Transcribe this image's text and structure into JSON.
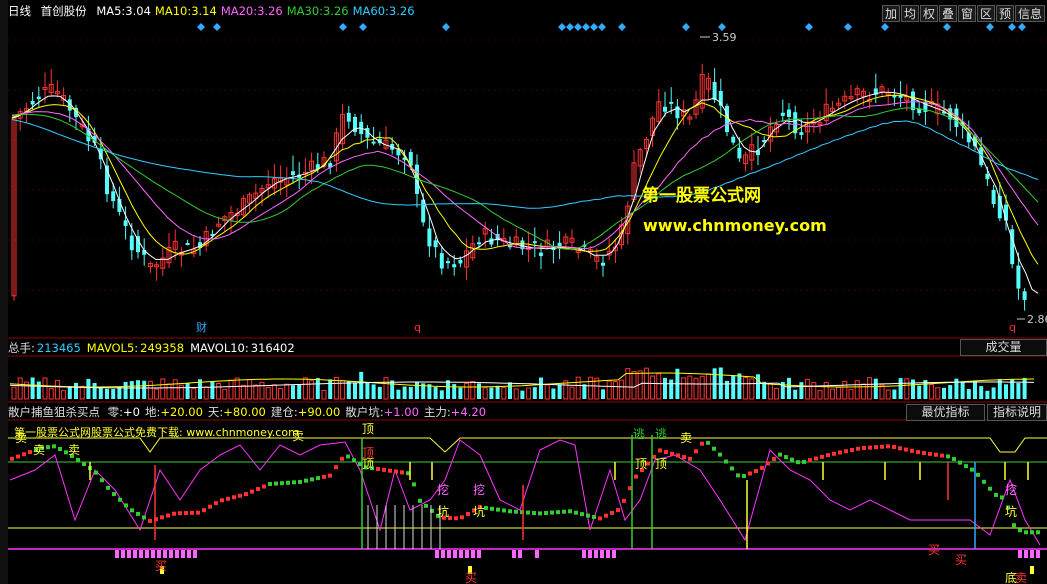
{
  "header": {
    "period": "日线",
    "stock_name": "首创股份",
    "ma": [
      {
        "label": "MA5:",
        "value": "3.04",
        "color": "#ffffff"
      },
      {
        "label": "MA10:",
        "value": "3.14",
        "color": "#ffff00"
      },
      {
        "label": "MA20:",
        "value": "3.26",
        "color": "#ff66ff"
      },
      {
        "label": "MA30:",
        "value": "3.26",
        "color": "#33cc33"
      },
      {
        "label": "MA60:",
        "value": "3.26",
        "color": "#33ccff"
      }
    ],
    "toolbar": [
      "加",
      "均",
      "权",
      "叠",
      "窗",
      "区",
      "预",
      "信息"
    ]
  },
  "price_chart": {
    "high_label": "3.59",
    "low_label": "2.86",
    "cai_marker": "财",
    "q_markers": [
      "q",
      "q"
    ],
    "watermark_title": "第一股票公式网",
    "watermark_url": "www.chnmoney.com"
  },
  "volume_panel": {
    "items": [
      {
        "label": "总手:",
        "value": "213465",
        "color": "#33ccff"
      },
      {
        "label": "MAVOL5:",
        "value": "249358",
        "color": "#ffff00"
      },
      {
        "label": "MAVOL10:",
        "value": "316402",
        "color": "#ffffff"
      }
    ],
    "button": "成交量"
  },
  "indicator_panel": {
    "name": "散户捕鱼狙杀买点",
    "params": [
      {
        "label": "零:",
        "value": "+0",
        "color": "#ffffff"
      },
      {
        "label": "地:",
        "value": "+20.00",
        "color": "#ffff00"
      },
      {
        "label": "天:",
        "value": "+80.00",
        "color": "#ffff00"
      },
      {
        "label": "建仓:",
        "value": "+90.00",
        "color": "#ffff00"
      },
      {
        "label": "散户坑:",
        "value": "+1.00",
        "color": "#ff66ff"
      },
      {
        "label": "主力:",
        "value": "+4.20",
        "color": "#ff66ff"
      }
    ],
    "buttons": [
      "最优指标",
      "指标说明"
    ],
    "banner": "第一股票公式网股票公式免费下载: www.chnmoney.com",
    "labels": {
      "sell": "卖",
      "buy": "买",
      "top": "顶",
      "top_red": "顶",
      "dig": "挖",
      "pit": "坑",
      "flee": "逃",
      "bottom": "底"
    }
  },
  "colors": {
    "up": "#ff3232",
    "down": "#54fcfc",
    "grid": "#8b0000",
    "ma5": "#ffffff",
    "ma10": "#ffff00",
    "ma20": "#ff66ff",
    "ma30": "#33cc33",
    "ma60": "#33ccff",
    "marker": "#33aaff",
    "watermark": "#ffff00"
  }
}
